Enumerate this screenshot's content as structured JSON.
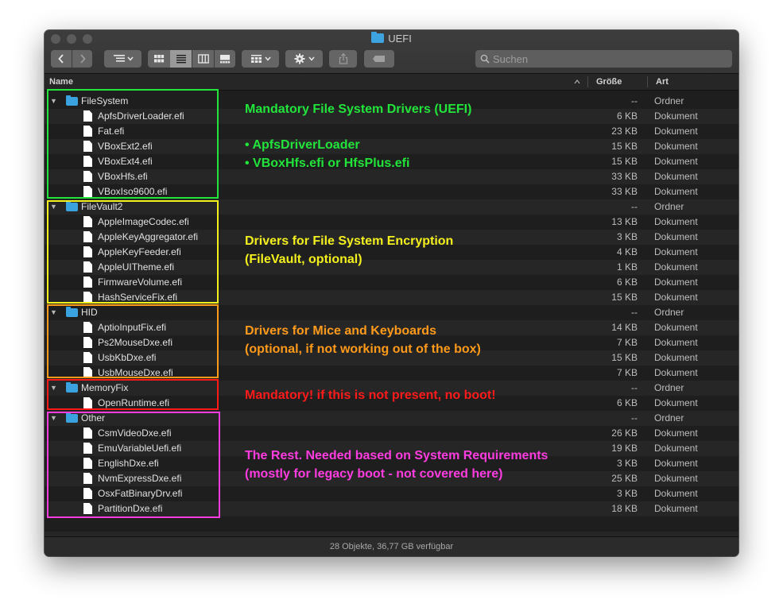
{
  "window": {
    "title": "UEFI"
  },
  "toolbar": {
    "search_placeholder": "Suchen"
  },
  "columns": {
    "name": "Name",
    "size": "Größe",
    "kind": "Art"
  },
  "rows": [
    {
      "name": "FileSystem",
      "size": "--",
      "kind": "Ordner",
      "folder": true
    },
    {
      "name": "ApfsDriverLoader.efi",
      "size": "6 KB",
      "kind": "Dokument"
    },
    {
      "name": "Fat.efi",
      "size": "23 KB",
      "kind": "Dokument"
    },
    {
      "name": "VBoxExt2.efi",
      "size": "15 KB",
      "kind": "Dokument"
    },
    {
      "name": "VBoxExt4.efi",
      "size": "15 KB",
      "kind": "Dokument"
    },
    {
      "name": "VBoxHfs.efi",
      "size": "33 KB",
      "kind": "Dokument"
    },
    {
      "name": "VBoxIso9600.efi",
      "size": "33 KB",
      "kind": "Dokument"
    },
    {
      "name": "FileVault2",
      "size": "--",
      "kind": "Ordner",
      "folder": true
    },
    {
      "name": "AppleImageCodec.efi",
      "size": "13 KB",
      "kind": "Dokument"
    },
    {
      "name": "AppleKeyAggregator.efi",
      "size": "3 KB",
      "kind": "Dokument"
    },
    {
      "name": "AppleKeyFeeder.efi",
      "size": "4 KB",
      "kind": "Dokument"
    },
    {
      "name": "AppleUITheme.efi",
      "size": "1 KB",
      "kind": "Dokument"
    },
    {
      "name": "FirmwareVolume.efi",
      "size": "6 KB",
      "kind": "Dokument"
    },
    {
      "name": "HashServiceFix.efi",
      "size": "15 KB",
      "kind": "Dokument"
    },
    {
      "name": "HID",
      "size": "--",
      "kind": "Ordner",
      "folder": true
    },
    {
      "name": "AptioInputFix.efi",
      "size": "14 KB",
      "kind": "Dokument"
    },
    {
      "name": "Ps2MouseDxe.efi",
      "size": "7 KB",
      "kind": "Dokument"
    },
    {
      "name": "UsbKbDxe.efi",
      "size": "15 KB",
      "kind": "Dokument"
    },
    {
      "name": "UsbMouseDxe.efi",
      "size": "7 KB",
      "kind": "Dokument"
    },
    {
      "name": "MemoryFix",
      "size": "--",
      "kind": "Ordner",
      "folder": true
    },
    {
      "name": "OpenRuntime.efi",
      "size": "6 KB",
      "kind": "Dokument"
    },
    {
      "name": "Other",
      "size": "--",
      "kind": "Ordner",
      "folder": true
    },
    {
      "name": "CsmVideoDxe.efi",
      "size": "26 KB",
      "kind": "Dokument"
    },
    {
      "name": "EmuVariableUefi.efi",
      "size": "19 KB",
      "kind": "Dokument"
    },
    {
      "name": "EnglishDxe.efi",
      "size": "3 KB",
      "kind": "Dokument"
    },
    {
      "name": "NvmExpressDxe.efi",
      "size": "25 KB",
      "kind": "Dokument"
    },
    {
      "name": "OsxFatBinaryDrv.efi",
      "size": "3 KB",
      "kind": "Dokument"
    },
    {
      "name": "PartitionDxe.efi",
      "size": "18 KB",
      "kind": "Dokument"
    }
  ],
  "status": {
    "text": "28 Objekte, 36,77 GB verfügbar"
  },
  "annotations": {
    "filesystem": {
      "line1": "Mandatory File System Drivers (UEFI)",
      "line2": "• ApfsDriverLoader",
      "line3": "• VBoxHfs.efi or HfsPlus.efi",
      "color": "#22e43a"
    },
    "filevault": {
      "line1": "Drivers for File System Encryption",
      "line2": "(FileVault, optional)",
      "color": "#f4f01e"
    },
    "hid": {
      "line1": "Drivers for Mice and Keyboards",
      "line2": "(optional, if not working out of the box)",
      "color": "#ff9a1a"
    },
    "memoryfix": {
      "line1": "Mandatory! if this is not present, no boot!",
      "color": "#ff1a1a"
    },
    "other": {
      "line1": "The Rest. Needed based on System Requirements",
      "line2": "(mostly for legacy boot - not covered here)",
      "color": "#ff3ce0"
    }
  }
}
